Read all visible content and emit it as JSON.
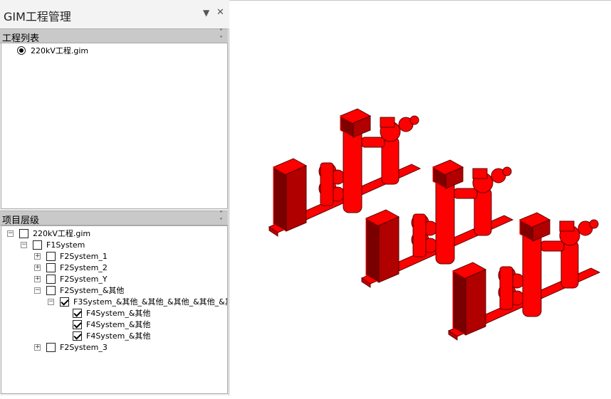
{
  "panel": {
    "title": "GIM工程管理",
    "pin_icon": "dropdown-arrow-icon",
    "close_icon": "close-icon"
  },
  "project_list": {
    "header": "工程列表",
    "chevron_icon": "collapse-chevron-icon",
    "items": [
      {
        "label": "220kV工程.gim",
        "selected": true
      }
    ]
  },
  "project_tree": {
    "header": "项目层级",
    "chevron_icon": "collapse-chevron-icon",
    "nodes": [
      {
        "label": "220kV工程.gim",
        "level": 0,
        "expander": "minus",
        "checked": false
      },
      {
        "label": "F1System",
        "level": 1,
        "expander": "minus",
        "checked": false
      },
      {
        "label": "F2System_1",
        "level": 2,
        "expander": "plus",
        "checked": false
      },
      {
        "label": "F2System_2",
        "level": 2,
        "expander": "plus",
        "checked": false
      },
      {
        "label": "F2System_Y",
        "level": 2,
        "expander": "plus",
        "checked": false
      },
      {
        "label": "F2System_&其他",
        "level": 2,
        "expander": "minus",
        "checked": false
      },
      {
        "label": "F3System_&其他_&其他_&其他_&其他_&其",
        "level": 3,
        "expander": "minus",
        "checked": true
      },
      {
        "label": "F4System_&其他",
        "level": 4,
        "expander": "none",
        "checked": true
      },
      {
        "label": "F4System_&其他",
        "level": 4,
        "expander": "none",
        "checked": true
      },
      {
        "label": "F4System_&其他",
        "level": 4,
        "expander": "none",
        "checked": true
      },
      {
        "label": "F2System_3",
        "level": 2,
        "expander": "plus",
        "checked": false
      }
    ]
  },
  "viewport": {
    "model_color": "#ff0000",
    "model_dark_color": "#5a0000",
    "model_count": 3
  }
}
